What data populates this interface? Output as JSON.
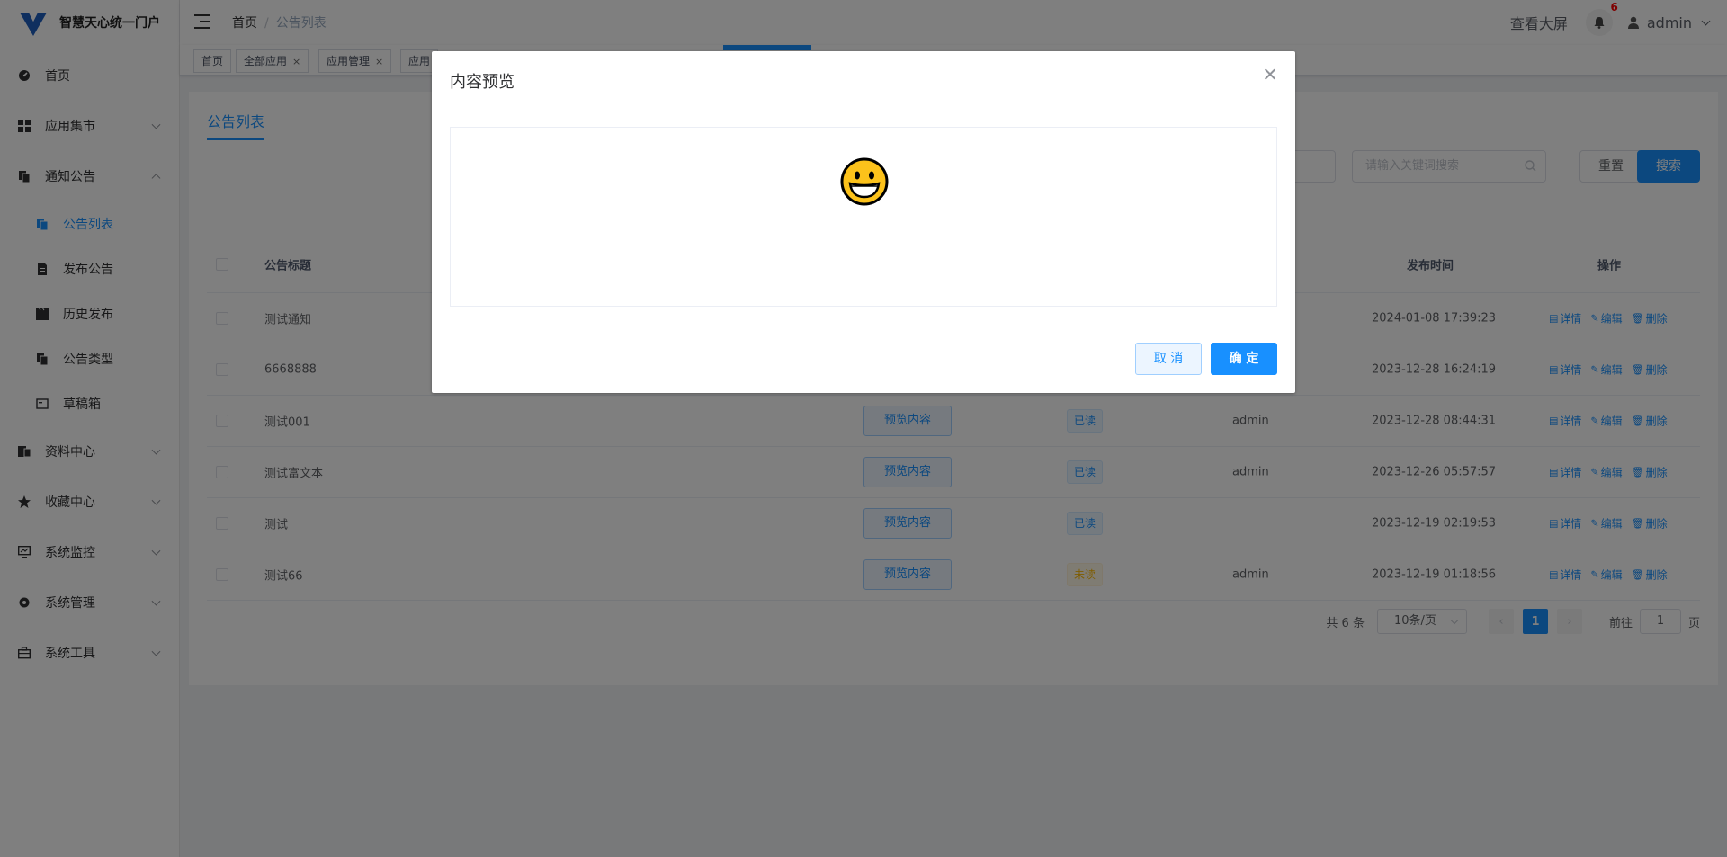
{
  "app": {
    "title": "智慧天心统一门户",
    "accent": "#1890ff"
  },
  "sidebar": {
    "items": [
      {
        "label": "首页",
        "icon": "dashboard-icon"
      },
      {
        "label": "应用集市",
        "icon": "grid-icon"
      },
      {
        "label": "通知公告",
        "icon": "copy-icon"
      },
      {
        "label": "资料中心",
        "icon": "document-icon"
      },
      {
        "label": "收藏中心",
        "icon": "star-icon"
      },
      {
        "label": "系统监控",
        "icon": "monitor-icon"
      },
      {
        "label": "系统管理",
        "icon": "gear-icon"
      },
      {
        "label": "系统工具",
        "icon": "toolbox-icon"
      }
    ],
    "submenu": [
      {
        "label": "公告列表",
        "icon": "copy-icon"
      },
      {
        "label": "发布公告",
        "icon": "file-icon"
      },
      {
        "label": "历史发布",
        "icon": "clapper-icon"
      },
      {
        "label": "公告类型",
        "icon": "copy-icon"
      },
      {
        "label": "草稿箱",
        "icon": "draft-icon"
      }
    ]
  },
  "header": {
    "breadcrumb": [
      "首页",
      "公告列表"
    ],
    "bigscreen": "查看大屏",
    "notify_count": "6",
    "user": "admin"
  },
  "tags": [
    {
      "label": "首页",
      "closable": false
    },
    {
      "label": "全部应用",
      "closable": true
    },
    {
      "label": "应用管理",
      "closable": true
    },
    {
      "label": "应用",
      "closable": false
    }
  ],
  "page": {
    "tab": "公告列表",
    "search_placeholder": "请输入关键词搜索",
    "reset": "重置",
    "search": "搜索"
  },
  "table": {
    "columns": {
      "title": "公告标题",
      "time": "发布时间",
      "ops": "操作"
    },
    "preview_label": "预览内容",
    "ops": [
      "详情",
      "编辑",
      "删除"
    ],
    "rows": [
      {
        "title": "测试通知",
        "status": "",
        "status_type": "",
        "publisher": "",
        "time": "2024-01-08 17:39:23"
      },
      {
        "title": "6668888",
        "status": "",
        "status_type": "",
        "publisher": "",
        "time": "2023-12-28 16:24:19"
      },
      {
        "title": "测试001",
        "status": "已读",
        "status_type": "read",
        "publisher": "admin",
        "time": "2023-12-28 08:44:31"
      },
      {
        "title": "测试富文本",
        "status": "已读",
        "status_type": "read",
        "publisher": "admin",
        "time": "2023-12-26 05:57:57"
      },
      {
        "title": "测试",
        "status": "已读",
        "status_type": "read",
        "publisher": "",
        "time": "2023-12-19 02:19:53"
      },
      {
        "title": "测试66",
        "status": "未读",
        "status_type": "unread",
        "publisher": "admin",
        "time": "2023-12-19 01:18:56"
      }
    ]
  },
  "pagination": {
    "total": "共 6 条",
    "page_size": "10条/页",
    "current": "1",
    "goto_label": "前往",
    "goto_value": "1",
    "page_suffix": "页"
  },
  "dialog": {
    "title": "内容预览",
    "content_icon": "grinning-face-emoji",
    "cancel": "取 消",
    "confirm": "确 定"
  }
}
